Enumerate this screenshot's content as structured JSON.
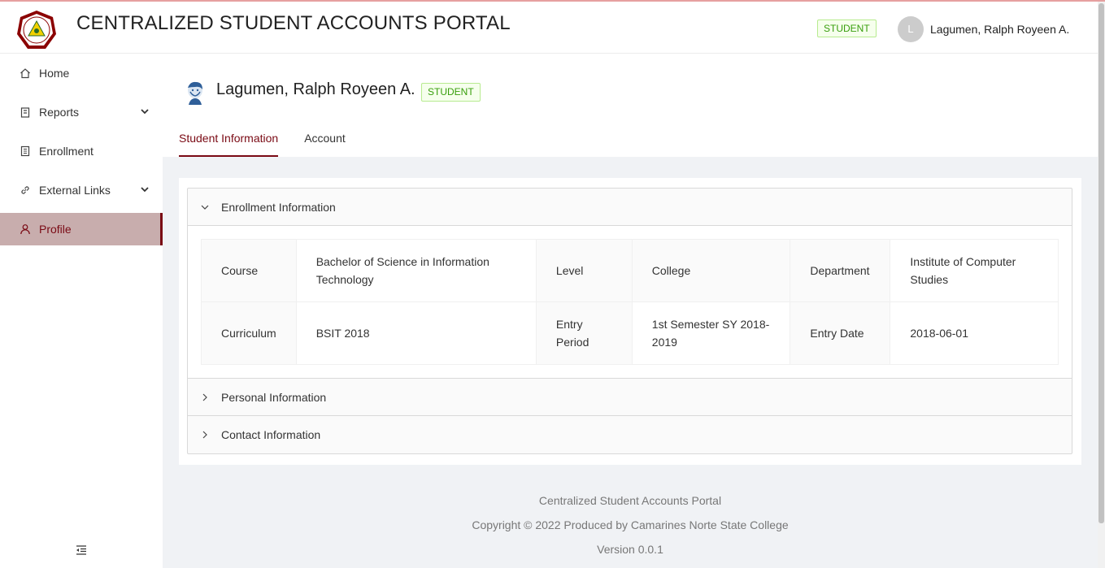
{
  "header": {
    "app_title": "CENTRALIZED STUDENT ACCOUNTS PORTAL",
    "role_tag": "STUDENT",
    "avatar_initial": "L",
    "user_name": "Lagumen, Ralph Royeen A."
  },
  "sidebar": {
    "items": [
      {
        "label": "Home",
        "icon": "home-icon"
      },
      {
        "label": "Reports",
        "icon": "reports-icon",
        "expandable": true
      },
      {
        "label": "Enrollment",
        "icon": "enrollment-icon"
      },
      {
        "label": "External Links",
        "icon": "link-icon",
        "expandable": true
      },
      {
        "label": "Profile",
        "icon": "user-icon",
        "active": true
      }
    ]
  },
  "profile": {
    "name": "Lagumen, Ralph Royeen A.",
    "role_tag": "STUDENT"
  },
  "tabs": [
    {
      "label": "Student Information",
      "active": true
    },
    {
      "label": "Account"
    }
  ],
  "panels": {
    "enrollment": {
      "title": "Enrollment Information",
      "rows": [
        [
          {
            "label": "Course",
            "value": "Bachelor of Science in Information Technology"
          },
          {
            "label": "Level",
            "value": ""
          },
          {
            "label": "College",
            "value": ""
          },
          {
            "label": "Department",
            "value": "Institute of Computer Studies"
          }
        ],
        [
          {
            "label": "Curriculum",
            "value": "BSIT 2018"
          },
          {
            "label": "Entry Period",
            "value": "1st Semester SY 2018-2019"
          },
          {
            "label": "Entry Date",
            "value": "2018-06-01"
          }
        ]
      ]
    },
    "personal": {
      "title": "Personal Information"
    },
    "contact": {
      "title": "Contact Information"
    }
  },
  "footer": {
    "line1": "Centralized Student Accounts Portal",
    "line2": "Copyright © 2022 Produced by Camarines Norte State College",
    "line3": "Version 0.0.1"
  },
  "colors": {
    "accent": "#7a0a14",
    "active_bg": "#c8adad",
    "tag_green": "#389e0d"
  }
}
